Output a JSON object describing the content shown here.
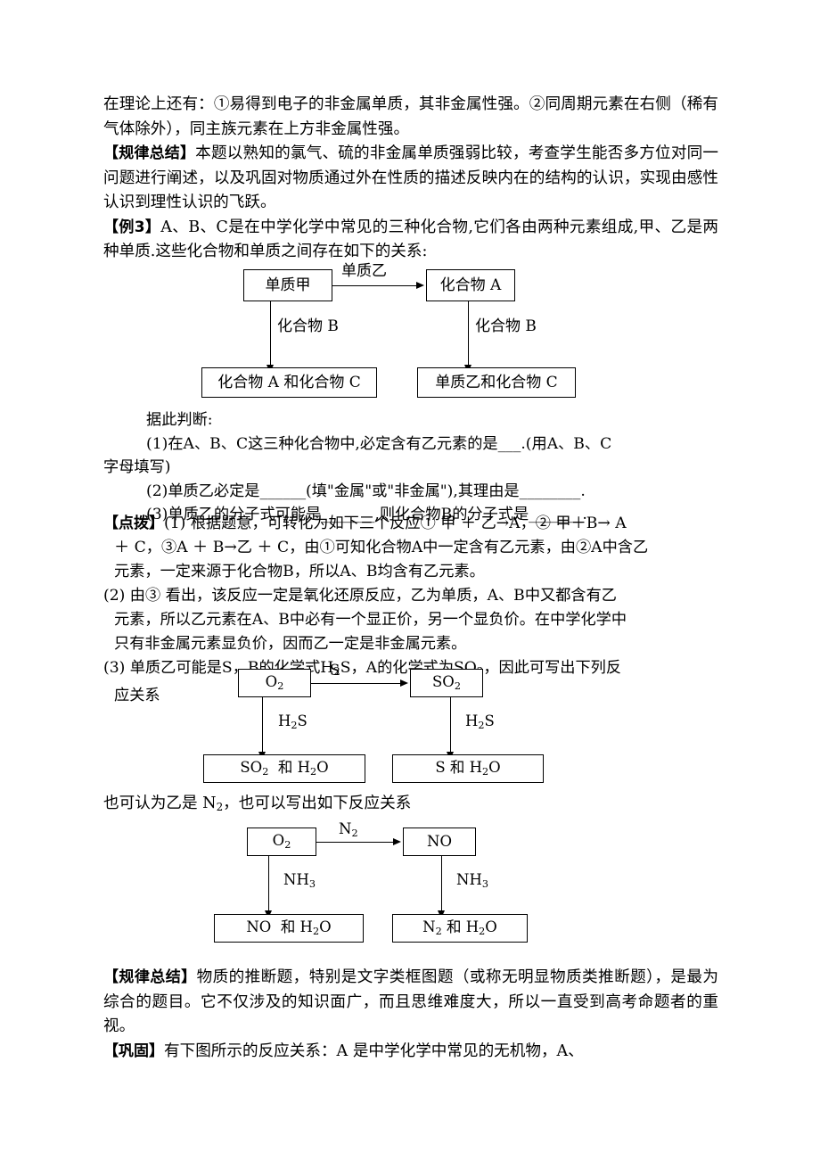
{
  "document": {
    "paragraphs": {
      "p1": "在理论上还有：①易得到电子的非金属单质，其非金属性强。②同周期元素在右侧（稀有气体除外），同主族元素在上方非金属性强。",
      "p2_label": "【规律总结】",
      "p2_text": "本题以熟知的氯气、硫的非金属单质强弱比较，考查学生能否多方位对同一问题进行阐述，以及巩固对物质通过外在性质的描述反映内在的结构的认识，实现由感性认识到理性认识的飞跃。",
      "p3_label": "【例3】",
      "p3_text": "A、B、C是在中学化学中常见的三种化合物,它们各由两种元素组成,甲、乙是两种单质.这些化合物和单质之间存在如下的关系:",
      "judge_line": "据此判断:",
      "q1_line1": "(1)在A、B、C这三种化合物中,必定含有乙元素的是___.(用A、B、C",
      "q1_line2": "字母填写)",
      "q2": "(2)单质乙必定是______(填\"金属\"或\"非金属\"),其理由是________.",
      "q3": "(3)单质乙的分子式可能是_______,则化合物B的分子式是_______.",
      "hint_label": "【点拨】",
      "hint1_line1": "(1) 根据题意，可转化为如下三个反应① 甲 ＋ 乙→A，② 甲＋B→ A",
      "hint1_line2": "＋ C，③A ＋ B→乙 ＋ C，由①可知化合物A中一定含有乙元素，由②A中含乙",
      "hint1_line3": "元素，一定来源于化合物B，所以A、B均含有乙元素。",
      "hint2_line1": "(2) 由③ 看出，该反应一定是氧化还原反应，乙为单质，A、B中又都含有乙",
      "hint2_line2": "元素，所以乙元素在A、B中必有一个显正价，另一个显负价。在中学化学中",
      "hint2_line3": "只有非金属元素显负价，因而乙一定是非金属元素。",
      "hint3_line1_a": "(3) 单质乙可能是S，B的化学式H",
      "hint3_line1_b": "S，A的化学式为SO",
      "hint3_line1_c": "，因此可写出下列反",
      "hint3_line2": "应关系",
      "alt_text_a": "也可认为乙是 N",
      "alt_text_b": "，也可以写出如下反应关系",
      "p4_label": "【规律总结】",
      "p4_text": "物质的推断题，特别是文字类框图题（或称无明显物质类推断题），是最为综合的题目。它不仅涉及的知识面广，而且思维难度大，所以一直受到高考命题者的重视。",
      "p5_label": "【巩固】",
      "p5_text": "有下图所示的反应关系：A 是中学化学中常见的无机物，A、"
    },
    "diagram1": {
      "name": "substance-relation-diagram",
      "box_top_left": "单质甲",
      "box_top_right": "化合物 A",
      "box_bottom_left": "化合物 A 和化合物 C",
      "box_bottom_right": "单质乙和化合物 C",
      "label_horizontal": "单质乙",
      "label_vertical_left": "化合物 B",
      "label_vertical_right": "化合物 B"
    },
    "diagram2": {
      "name": "sulfur-reaction-diagram",
      "box_top_left_a": "O",
      "box_top_left_sub": "2",
      "box_top_right_a": "SO",
      "box_top_right_sub": "2",
      "box_bottom_left": "SO₂ 和 H₂O",
      "box_bottom_right": "S 和 H₂O",
      "label_horizontal": "S",
      "label_vertical_left": "H₂S",
      "label_vertical_right": "H₂S"
    },
    "diagram3": {
      "name": "nitrogen-reaction-diagram",
      "box_top_left_a": "O",
      "box_top_left_sub": "2",
      "box_top_right": "NO",
      "box_bottom_left": "NO 和 H₂O",
      "box_bottom_right": "N₂ 和 H₂O",
      "label_horizontal": "N₂",
      "label_vertical_left": "NH₃",
      "label_vertical_right": "NH₃"
    }
  }
}
